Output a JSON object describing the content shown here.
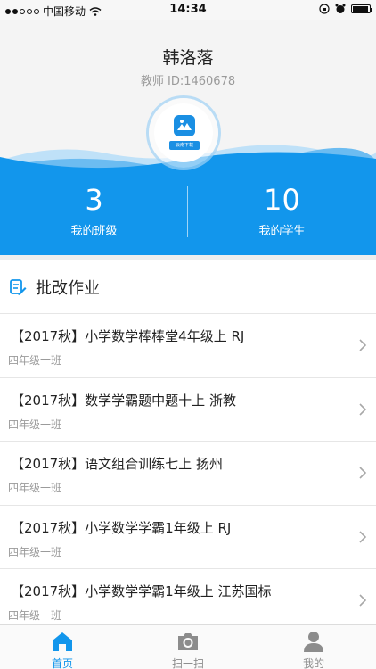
{
  "status_bar": {
    "carrier": "中国移动",
    "time": "14:34"
  },
  "profile": {
    "name": "韩洛落",
    "teacher_id": "教师 ID:1460678",
    "app_badge": "云南下载"
  },
  "stats": {
    "classes": {
      "value": "3",
      "label": "我的班级"
    },
    "students": {
      "value": "10",
      "label": "我的学生"
    }
  },
  "section": {
    "title": "批改作业",
    "icon": "edit-note-icon"
  },
  "assignments": [
    {
      "title": "【2017秋】小学数学棒棒堂4年级上  RJ",
      "class": "四年级一班"
    },
    {
      "title": "【2017秋】数学学霸题中题十上 浙教",
      "class": "四年级一班"
    },
    {
      "title": "【2017秋】语文组合训练七上  扬州",
      "class": "四年级一班"
    },
    {
      "title": "【2017秋】小学数学学霸1年级上  RJ",
      "class": "四年级一班"
    },
    {
      "title": "【2017秋】小学数学学霸1年级上 江苏国标",
      "class": "四年级一班"
    }
  ],
  "tabbar": {
    "home": "首页",
    "scan": "扫一扫",
    "mine": "我的"
  },
  "colors": {
    "accent": "#1296ec",
    "muted": "#9a9a9a"
  }
}
